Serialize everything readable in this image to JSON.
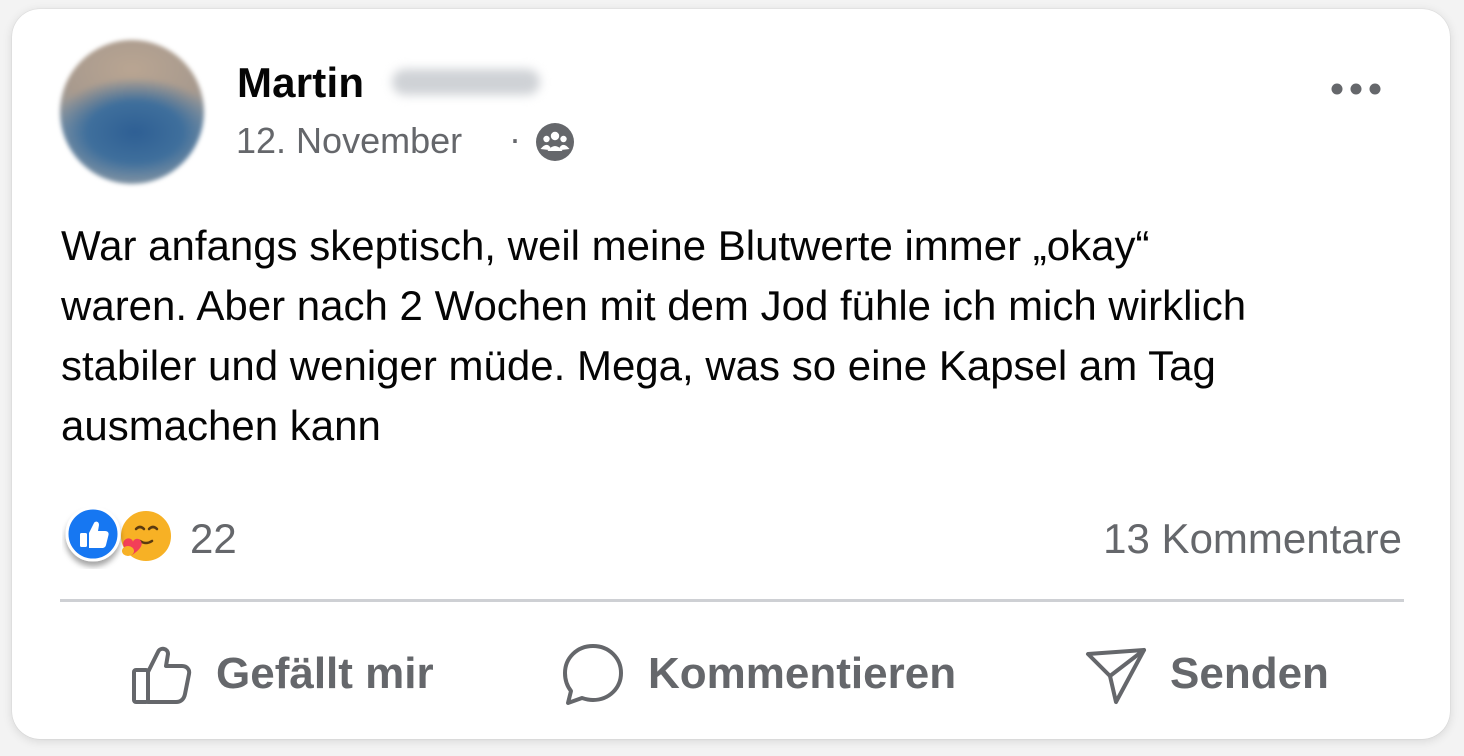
{
  "post": {
    "author_first_name": "Martin",
    "date": "12. November",
    "separator": "·",
    "audience_icon": "friends-icon",
    "text": "War anfangs skeptisch, weil meine Blutwerte immer „okay“\nwaren. Aber nach 2 Wochen mit dem Jod fühle ich mich wirklich\nstabiler und weniger müde. Mega, was so eine Kapsel am Tag\nausmachen kann",
    "reaction_icons": [
      "like-icon",
      "care-icon"
    ],
    "reaction_count": "22",
    "comment_count": "13 Kommentare"
  },
  "actions": {
    "like_label": "Gefällt mir",
    "comment_label": "Kommentieren",
    "send_label": "Senden"
  },
  "colors": {
    "secondary_text": "#65676b",
    "like_blue": "#1877f2",
    "divider": "#ced0d4"
  }
}
